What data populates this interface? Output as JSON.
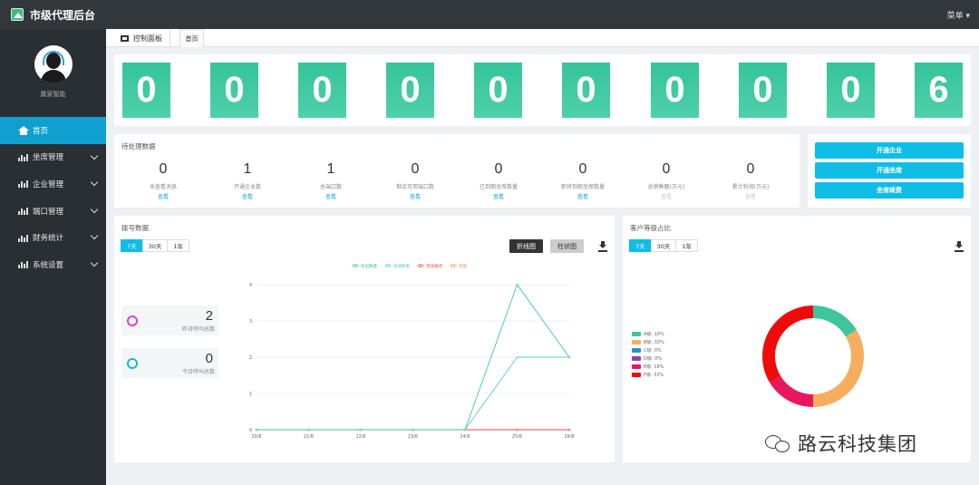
{
  "app": {
    "title": "市级代理后台",
    "menu_label": "菜单"
  },
  "user": {
    "name": "赢家智能"
  },
  "sidebar": {
    "items": [
      {
        "label": "首页",
        "icon": "home-icon",
        "active": true
      },
      {
        "label": "坐席管理",
        "icon": "bar-chart-icon"
      },
      {
        "label": "企业管理",
        "icon": "bar-chart-icon"
      },
      {
        "label": "端口管理",
        "icon": "bar-chart-icon"
      },
      {
        "label": "财务统计",
        "icon": "bar-chart-icon"
      },
      {
        "label": "系统设置",
        "icon": "bar-chart-icon"
      }
    ]
  },
  "tabs": {
    "dashboard": "控制面板",
    "home": "首页"
  },
  "counter": {
    "digits": [
      "0",
      "0",
      "0",
      "0",
      "0",
      "0",
      "0",
      "0",
      "0",
      "6"
    ]
  },
  "pending": {
    "title": "待处理数据",
    "stats": [
      {
        "value": "0",
        "label": "未查看消息",
        "link": "查看"
      },
      {
        "value": "1",
        "label": "开通企业数",
        "link": "查看"
      },
      {
        "value": "1",
        "label": "总端口数",
        "link": "查看"
      },
      {
        "value": "0",
        "label": "剩余可用端口数",
        "link": "查看"
      },
      {
        "value": "0",
        "label": "已到期坐席数量",
        "link": "查看"
      },
      {
        "value": "0",
        "label": "即将到期坐席数量",
        "link": "查看"
      },
      {
        "value": "0",
        "label": "总销售额(万元)",
        "link": "查看"
      },
      {
        "value": "0",
        "label": "累计利润(万元)",
        "link": "查看"
      }
    ]
  },
  "actions": {
    "open_company": "开通企业",
    "open_seat": "开通坐席",
    "seat_renew": "坐席续费"
  },
  "calls": {
    "title": "拨号数据",
    "ranges": [
      "7天",
      "30天",
      "1年"
    ],
    "chart_types": {
      "line": "折线图",
      "bar": "柱状图"
    },
    "yesterday": {
      "value": "2",
      "label": "昨日呼叫总数"
    },
    "today": {
      "value": "0",
      "label": "今日呼叫总数"
    }
  },
  "grades": {
    "title": "客户等级占比",
    "ranges": [
      "7天",
      "30天",
      "1年"
    ]
  },
  "chart_data": [
    {
      "type": "line",
      "x": [
        "20/6",
        "21/6",
        "22/6",
        "23/6",
        "24/6",
        "25/6",
        "26/6"
      ],
      "ylim": [
        0,
        4
      ],
      "yticks": [
        "0",
        "1",
        "2",
        "3",
        "4"
      ],
      "series": [
        {
          "name": "呼出数量",
          "color": "#3fc59b",
          "values": [
            0,
            0,
            0,
            0,
            0,
            4,
            2
          ]
        },
        {
          "name": "接通数量",
          "color": "#5ec8dc",
          "values": [
            0,
            0,
            0,
            0,
            0,
            2,
            2
          ]
        },
        {
          "name": "无效通话",
          "color": "#e8474c",
          "values": [
            0,
            0,
            0,
            0,
            0,
            0,
            0
          ]
        },
        {
          "name": "拒接",
          "color": "#f0955a",
          "values": [
            0,
            0,
            0,
            0,
            0,
            0,
            0
          ]
        }
      ]
    },
    {
      "type": "pie",
      "slices": [
        {
          "label": "A级: 16%",
          "value": 16,
          "color": "#3fc59b"
        },
        {
          "label": "B级: 33%",
          "value": 33,
          "color": "#f5ad5e"
        },
        {
          "label": "C级: 0%",
          "value": 0,
          "color": "#2a8fd0"
        },
        {
          "label": "D级: 0%",
          "value": 0,
          "color": "#8e44ad"
        },
        {
          "label": "E级: 16%",
          "value": 16,
          "color": "#e8175d"
        },
        {
          "label": "F级: 33%",
          "value": 33,
          "color": "#f00a0a"
        }
      ]
    }
  ],
  "watermark": {
    "text": "路云科技集团",
    "icon": "wechat-icon"
  }
}
